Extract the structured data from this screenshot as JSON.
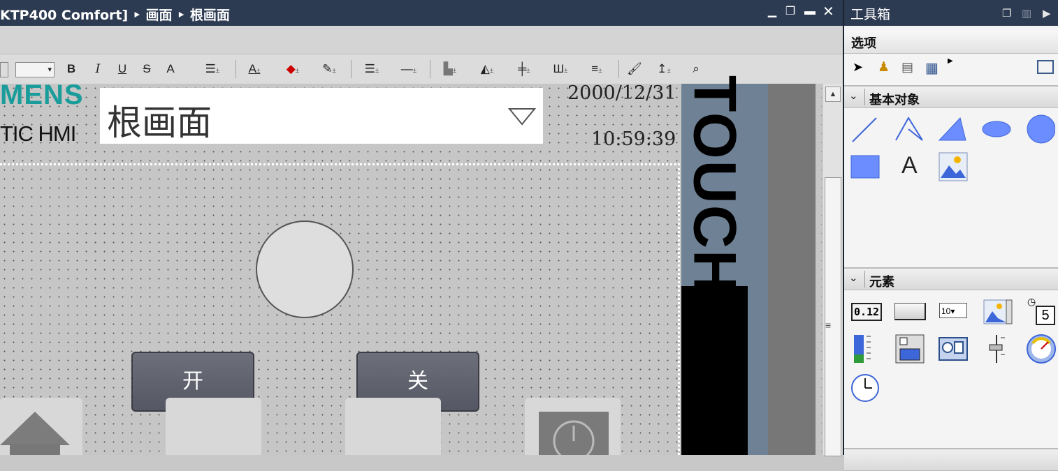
{
  "editor": {
    "breadcrumb": "KTP400 Comfort] ‣ 画面 ‣ 根画面",
    "window_controls": {
      "minimize": "▁",
      "restore": "❐",
      "maximize": "▬",
      "close": "✕"
    }
  },
  "format_toolbar": {
    "bold": "B",
    "italic": "I",
    "underline": "U",
    "strike": "S",
    "font_size": "A"
  },
  "hmi_screen": {
    "logo": "MENS",
    "brand": "TIC HMI",
    "screen_name": "根画面",
    "date": "2000/12/31",
    "time": "10:59:39",
    "touch_label": "TOUCH",
    "button_on": "开",
    "button_off": "关"
  },
  "toolbox": {
    "title": "工具箱",
    "options_label": "选项",
    "sections": {
      "basic_objects": "基本对象",
      "elements": "元素"
    },
    "text_tool": "A",
    "io_field_value": "0.12",
    "clock_value": "5"
  },
  "colors": {
    "title_bar": "#2c3a52",
    "logo": "#1a9d9a",
    "shape_blue": "#6c8dff",
    "touch_panel": "#6f8194"
  }
}
